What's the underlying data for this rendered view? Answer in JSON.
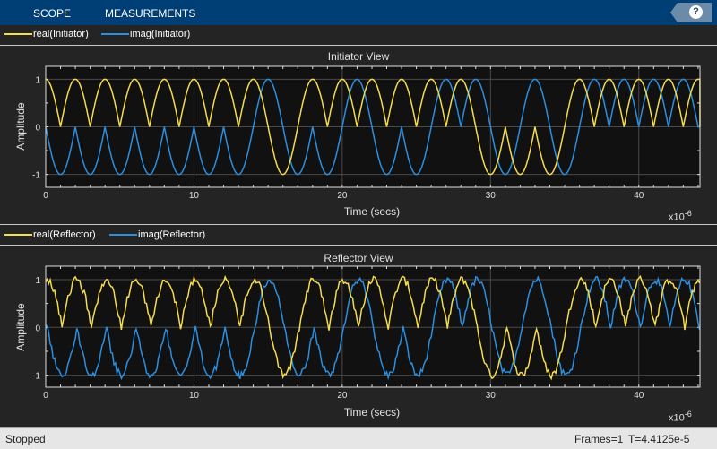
{
  "toolbar": {
    "tabs": [
      "SCOPE",
      "MEASUREMENTS"
    ],
    "help_label": "?"
  },
  "colors": {
    "real": "#f5dc4a",
    "imag": "#2a8fe0",
    "toolbar": "#003f75"
  },
  "status": {
    "state": "Stopped",
    "frames": "Frames=1",
    "time": "T=4.4125e-5"
  },
  "chart_data": [
    {
      "type": "line",
      "title": "Initiator View",
      "xlabel": "Time (secs)",
      "ylabel": "Amplitude",
      "x_exponent_label": "x10",
      "x_exponent": "-6",
      "xlim": [
        0,
        44.125
      ],
      "ylim": [
        -1.27,
        1.27
      ],
      "xticks": [
        "0",
        "10",
        "20",
        "30",
        "40"
      ],
      "yticks": [
        "1",
        "0",
        "-1"
      ],
      "grid": true,
      "legend": [
        "real(Initiator)",
        "imag(Initiator)"
      ],
      "legend_placement": "top-left",
      "signal_model": "exp(j*phase); phase changes by step*pi/2 per microsecond",
      "phase_steps": [
        -1,
        1,
        -1,
        1,
        -1,
        1,
        -1,
        1,
        -1,
        1,
        -1,
        1,
        -1,
        1,
        1,
        1,
        1,
        1,
        -1,
        1,
        1,
        -1,
        -1,
        1,
        -1,
        1,
        1,
        -1,
        1,
        1,
        1,
        -1,
        -1,
        1,
        1,
        1,
        1,
        -1,
        1,
        -1,
        1,
        -1,
        1,
        -1
      ],
      "delay_us": 0,
      "noise_amplitude": 0
    },
    {
      "type": "line",
      "title": "Reflector View",
      "xlabel": "Time (secs)",
      "ylabel": "Amplitude",
      "x_exponent_label": "x10",
      "x_exponent": "-6",
      "xlim": [
        0,
        44.125
      ],
      "ylim": [
        -1.25,
        1.28
      ],
      "xticks": [
        "0",
        "10",
        "20",
        "30",
        "40"
      ],
      "yticks": [
        "1",
        "0",
        "-1"
      ],
      "grid": true,
      "legend": [
        "real(Reflector)",
        "imag(Reflector)"
      ],
      "legend_placement": "top-left",
      "signal_model": "exp(j*phase); phase changes by step*pi/2 per microsecond",
      "phase_steps": [
        -1,
        1,
        -1,
        1,
        -1,
        1,
        -1,
        1,
        -1,
        1,
        -1,
        1,
        -1,
        1,
        1,
        1,
        1,
        1,
        -1,
        1,
        1,
        -1,
        -1,
        1,
        -1,
        1,
        1,
        -1,
        1,
        1,
        1,
        -1,
        -1,
        1,
        1,
        1,
        1,
        -1,
        1,
        -1,
        1,
        -1,
        1,
        -1
      ],
      "delay_us": 0.1,
      "noise_amplitude": 0.08
    }
  ]
}
